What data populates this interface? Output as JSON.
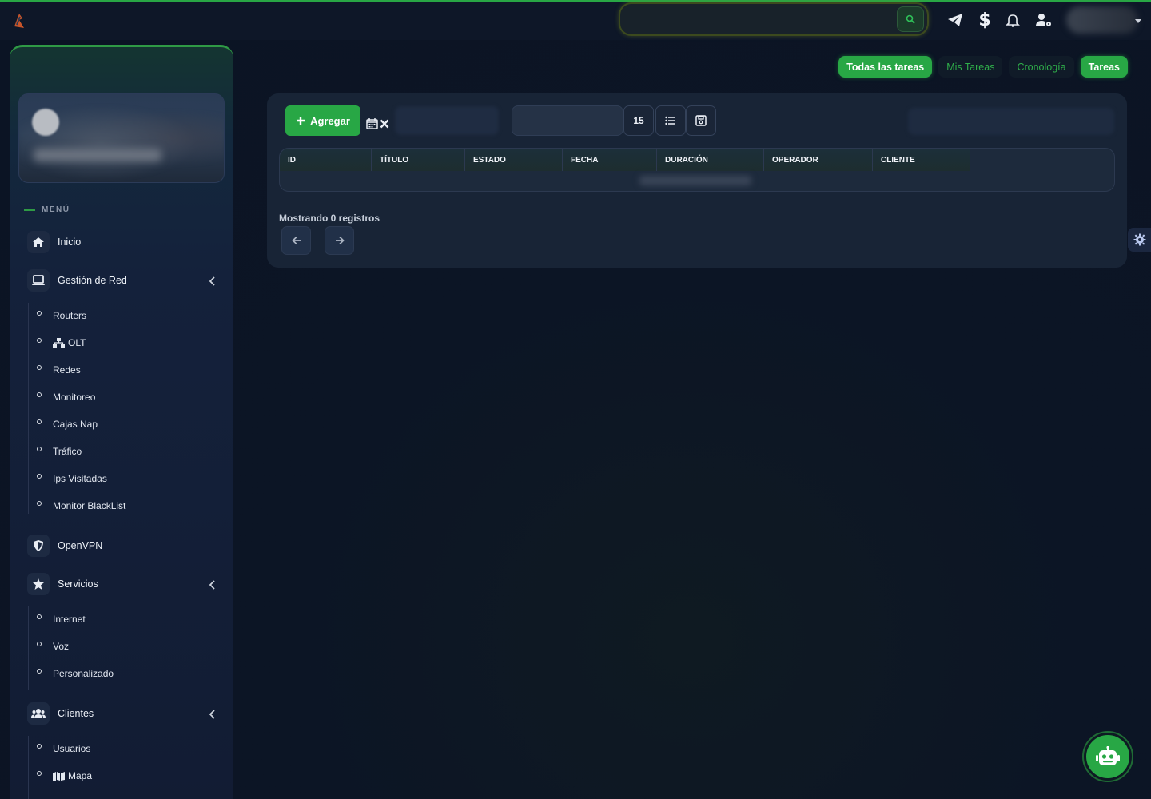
{
  "search": {
    "placeholder": ""
  },
  "sidebar": {
    "menu_heading": "MENÚ",
    "items": {
      "inicio": "Inicio",
      "gestion": "Gestión de Red",
      "openvpn": "OpenVPN",
      "servicios": "Servicios",
      "clientes": "Clientes"
    },
    "gestion_sub": [
      "Routers",
      "OLT",
      "Redes",
      "Monitoreo",
      "Cajas Nap",
      "Tráfico",
      "Ips Visitadas",
      "Monitor BlackList"
    ],
    "servicios_sub": [
      "Internet",
      "Voz",
      "Personalizado"
    ],
    "clientes_sub": [
      "Usuarios",
      "Mapa"
    ]
  },
  "tabs": [
    {
      "label": "Todas las tareas",
      "active": true
    },
    {
      "label": "Mis Tareas",
      "active": false
    },
    {
      "label": "Cronología",
      "active": false
    },
    {
      "label": "Tareas",
      "active": true
    }
  ],
  "toolbar": {
    "add_label": "Agregar",
    "page_length": "15"
  },
  "table": {
    "columns": [
      "ID",
      "TÍTULO",
      "ESTADO",
      "FECHA",
      "DURACIÓN",
      "OPERADOR",
      "CLIENTE"
    ]
  },
  "pagination": {
    "info": "Mostrando 0 registros"
  },
  "colors": {
    "accent": "#28a745",
    "background": "#0b1424",
    "panel": "#182436"
  }
}
